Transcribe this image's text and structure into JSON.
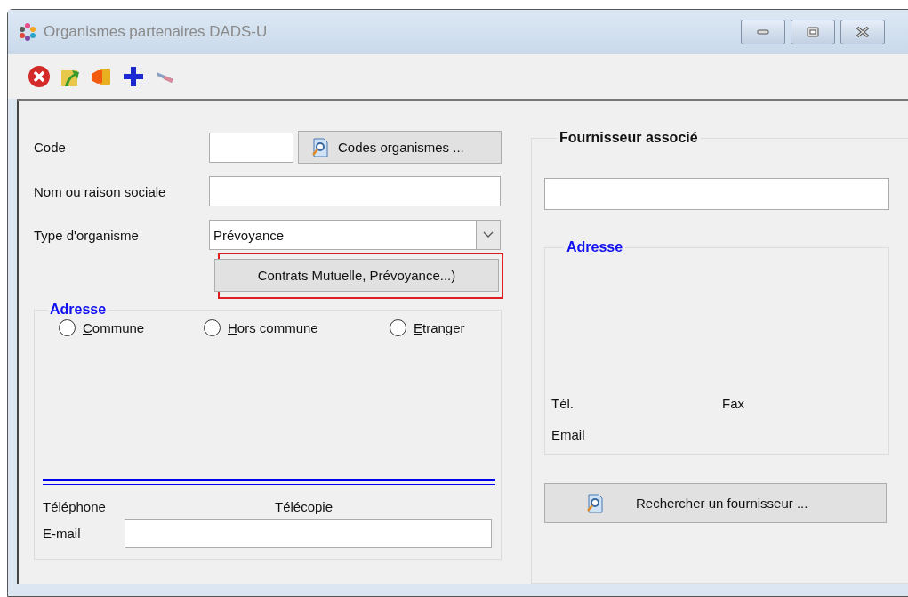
{
  "window": {
    "title": "Organismes partenaires DADS-U"
  },
  "form": {
    "code": {
      "label": "Code"
    },
    "codes_button": {
      "label": "Codes organismes ..."
    },
    "name": {
      "label": "Nom ou raison sociale"
    },
    "type": {
      "label": "Type d'organisme",
      "value": "Prévoyance"
    },
    "contracts_button": {
      "label": "Contrats Mutuelle, Prévoyance...)",
      "highlighted": true
    },
    "address": {
      "legend": "Adresse",
      "radios": [
        {
          "label": "Commune",
          "selected": false
        },
        {
          "label": "Hors commune",
          "selected": false
        },
        {
          "label": "Etranger",
          "selected": false
        }
      ],
      "phone_label": "Téléphone",
      "fax_label": "Télécopie",
      "email": {
        "label": "E-mail"
      }
    }
  },
  "supplier": {
    "legend": "Fournisseur associé",
    "address": {
      "legend": "Adresse",
      "phone_label": "Tél.",
      "fax_label": "Fax",
      "email_label": "Email"
    },
    "search_button": {
      "label": "Rechercher un fournisseur ..."
    }
  }
}
